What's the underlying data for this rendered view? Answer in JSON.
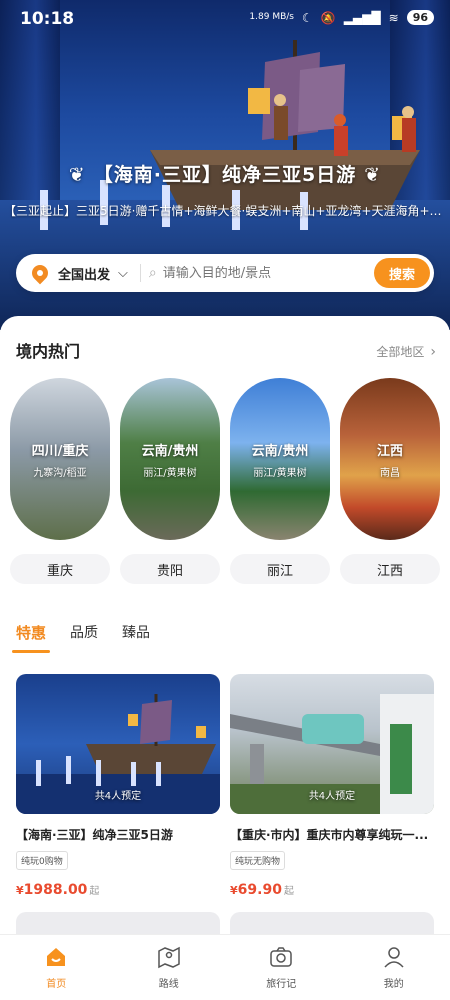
{
  "status_bar": {
    "time": "10:18",
    "net_speed": "1.89 MB/s",
    "battery": "96"
  },
  "banner": {
    "title": "【海南·三亚】纯净三亚5日游",
    "subtitle": "【三亚起止】三亚5日游·赠千古情+海鲜大餐·蜈支洲+南山+亚龙湾+天涯海角+槟榔谷·..."
  },
  "search": {
    "departure": "全国出发",
    "placeholder": "请输入目的地/景点",
    "button": "搜索"
  },
  "hot_section": {
    "title": "境内热门",
    "more": "全部地区"
  },
  "destinations": [
    {
      "title": "四川/重庆",
      "subtitle": "九寨沟/稻亚",
      "city": "重庆"
    },
    {
      "title": "云南/贵州",
      "subtitle": "丽江/黄果树",
      "city": "贵阳"
    },
    {
      "title": "云南/贵州",
      "subtitle": "丽江/黄果树",
      "city": "丽江"
    },
    {
      "title": "江西",
      "subtitle": "南昌",
      "city": "江西"
    }
  ],
  "tabs": [
    "特惠",
    "品质",
    "臻品"
  ],
  "products": [
    {
      "booked": "共4人预定",
      "title": "【海南·三亚】纯净三亚5日游",
      "tag": "纯玩0购物",
      "currency": "¥",
      "price": "1988.00",
      "suffix": "起"
    },
    {
      "booked": "共4人预定",
      "title": "【重庆·市内】重庆市内尊享纯玩一...",
      "tag": "纯玩无购物",
      "currency": "¥",
      "price": "69.90",
      "suffix": "起"
    }
  ],
  "bottom_nav": [
    "首页",
    "路线",
    "旅行记",
    "我的"
  ],
  "colors": {
    "accent": "#f7921e",
    "price": "#e94b2f"
  }
}
